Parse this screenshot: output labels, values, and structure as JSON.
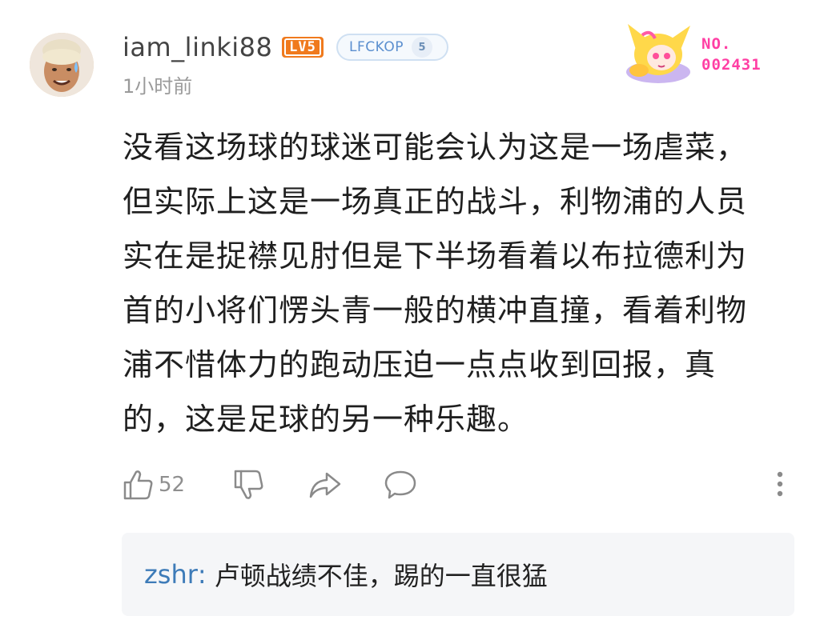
{
  "comment": {
    "username": "iam_linki88",
    "level_badge": "LV5",
    "fan_badge": {
      "name": "LFCKOP",
      "level": "5"
    },
    "timestamp": "1小时前",
    "sticker_number": "NO.\n002431",
    "body": "没看这场球的球迷可能会认为这是一场虐菜，\n但实际上这是一场真正的战斗，利物浦的人员\n实在是捉襟见肘但是下半场看着以布拉德利为\n首的小将们愣头青一般的横冲直撞，看着利物\n浦不惜体力的跑动压迫一点点收到回报，真\n的，这是足球的另一种乐趣。",
    "actions": {
      "like_count": "52",
      "icons": [
        "thumbs-up-icon",
        "thumbs-down-icon",
        "share-icon",
        "reply-icon",
        "more-icon"
      ]
    }
  },
  "reply": {
    "user": "zshr",
    "separator": ":",
    "text": "卢顿战绩不佳，踢的一直很猛"
  },
  "colors": {
    "level_badge": "#f07a1d",
    "fan_badge_text": "#5b8fcf",
    "sticker_number": "#ff3fa4",
    "reply_user": "#3d7bb8",
    "reply_bg": "#f5f6f8"
  }
}
